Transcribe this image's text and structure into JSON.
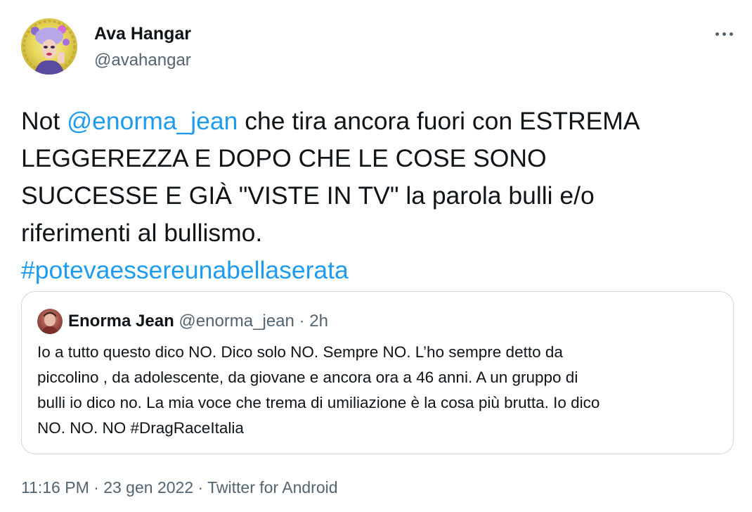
{
  "author": {
    "name": "Ava Hangar",
    "handle": "@avahangar",
    "avatar_icon": "profile-avatar-drag-queen"
  },
  "more_icon": "more-horizontal-icon",
  "tweet": {
    "lines": [
      {
        "prefix": "Not ",
        "mention": "@enorma_jean",
        "suffix": " che tira ancora fuori con ESTREMA"
      },
      {
        "text": "LEGGEREZZA E DOPO CHE LE COSE SONO"
      },
      {
        "text": "SUCCESSE E GIÀ \"VISTE IN TV\" la parola bulli e/o"
      },
      {
        "text": "riferimenti al bullismo."
      }
    ],
    "hashtag": "#potevaessereunabellaserata"
  },
  "quote": {
    "name": "Enorma Jean",
    "handle": "@enorma_jean",
    "separator": "·",
    "time": "2h",
    "avatar_icon": "profile-avatar",
    "lines": [
      "Io a tutto questo dico NO. Dico solo NO. Sempre NO. L’ho sempre detto da",
      "piccolino , da adolescente, da giovane e ancora ora a 46 anni. A un gruppo di",
      "bulli io dico no. La mia voce che trema di umiliazione è la cosa più brutta. Io dico",
      "NO. NO. NO #DragRaceItalia"
    ]
  },
  "meta": {
    "time": "11:16 PM",
    "sep1": "·",
    "date": "23 gen 2022",
    "sep2": "·",
    "source": "Twitter for Android"
  },
  "colors": {
    "link": "#1d9bf0",
    "text": "#0f1419",
    "secondary": "#536471",
    "border": "#cfd9de"
  }
}
